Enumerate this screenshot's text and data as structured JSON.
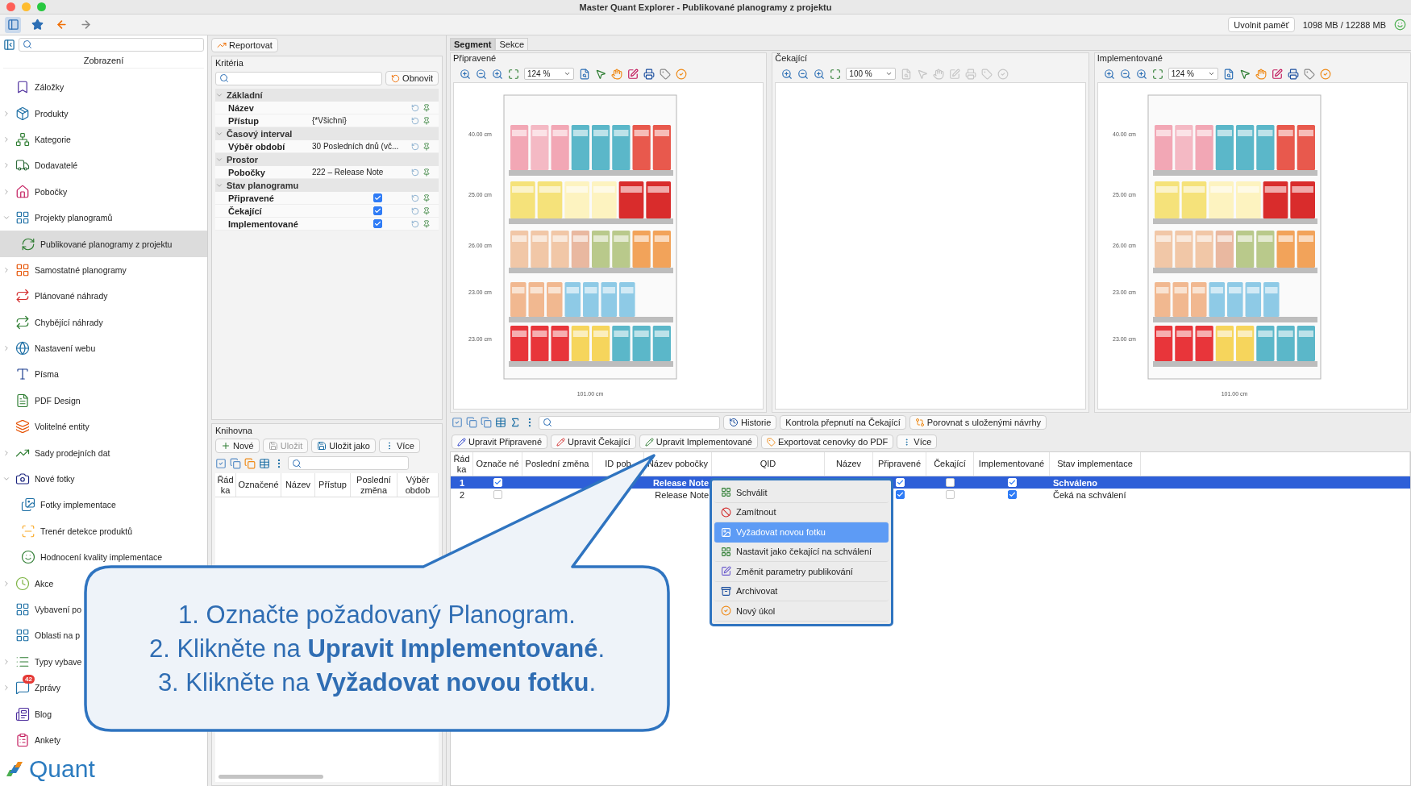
{
  "window": {
    "title": "Master Quant Explorer - Publikované planogramy z projektu"
  },
  "toolbar": {
    "memory_button": "Uvolnit paměť",
    "memory_usage": "1098 MB / 12288 MB"
  },
  "sidebar": {
    "heading": "Zobrazení",
    "logo": "Quant",
    "items": [
      {
        "label": "Záložky",
        "selected": false
      },
      {
        "label": "Produkty",
        "expanded": false,
        "selected": false
      },
      {
        "label": "Kategorie",
        "expanded": false,
        "selected": false
      },
      {
        "label": "Dodavatelé",
        "expanded": false,
        "selected": false
      },
      {
        "label": "Pobočky",
        "expanded": false,
        "selected": false
      },
      {
        "label": "Projekty planogramů",
        "expanded": true,
        "selected": false,
        "children": [
          {
            "label": "Publikované planogramy z projektu",
            "selected": true
          }
        ]
      },
      {
        "label": "Samostatné planogramy",
        "expanded": false,
        "selected": false
      },
      {
        "label": "Plánované náhrady",
        "selected": false
      },
      {
        "label": "Chybějící náhrady",
        "selected": false
      },
      {
        "label": "Nastavení webu",
        "expanded": false,
        "selected": false
      },
      {
        "label": "Písma",
        "selected": false
      },
      {
        "label": "PDF Design",
        "selected": false
      },
      {
        "label": "Volitelné entity",
        "selected": false
      },
      {
        "label": "Sady prodejních dat",
        "expanded": false,
        "selected": false
      },
      {
        "label": "Nové fotky",
        "expanded": true,
        "selected": false,
        "children": [
          {
            "label": "Fotky implementace",
            "selected": false
          },
          {
            "label": "Trenér detekce produktů",
            "selected": false
          },
          {
            "label": "Hodnocení kvality implementace",
            "selected": false
          }
        ]
      },
      {
        "label": "Akce",
        "expanded": false,
        "selected": false
      },
      {
        "label": "Vybavení po",
        "selected": false
      },
      {
        "label": "Oblasti na p",
        "selected": false
      },
      {
        "label": "Typy vybave",
        "expanded": false,
        "selected": false
      },
      {
        "label": "Zprávy",
        "expanded": false,
        "selected": false,
        "badge": "42"
      },
      {
        "label": "Blog",
        "selected": false
      },
      {
        "label": "Ankety",
        "selected": false
      }
    ]
  },
  "criteria": {
    "report_button": "Reportovat",
    "title": "Kritéria",
    "refresh_button": "Obnovit",
    "groups": [
      {
        "label": "Základní",
        "expanded": true,
        "rows": [
          {
            "kind": "text",
            "label": "Název"
          },
          {
            "kind": "text",
            "label": "Přístup",
            "value": "{*Všichni}"
          }
        ]
      },
      {
        "label": "Časový interval",
        "expanded": true,
        "rows": [
          {
            "kind": "text",
            "label": "Výběr období",
            "value": "30 Posledních dnů (vč..."
          }
        ]
      },
      {
        "label": "Prostor",
        "expanded": true,
        "rows": [
          {
            "kind": "text",
            "label": "Pobočky",
            "value": "222 – Release Note"
          }
        ]
      },
      {
        "label": "Stav planogramu",
        "expanded": true,
        "rows": [
          {
            "kind": "checkbox",
            "label": "Připravené",
            "checked": true
          },
          {
            "kind": "checkbox",
            "label": "Čekající",
            "checked": true
          },
          {
            "kind": "checkbox",
            "label": "Implementované",
            "checked": true
          }
        ]
      }
    ]
  },
  "library": {
    "title": "Knihovna",
    "buttons": [
      {
        "label": "Nové",
        "disabled": false
      },
      {
        "label": "Uložit",
        "disabled": true
      },
      {
        "label": "Uložit jako",
        "disabled": false
      },
      {
        "label": "Více",
        "disabled": false
      }
    ],
    "columns": [
      "Řád ka",
      "Označené",
      "Název",
      "Přístup",
      "Poslední změna",
      "Výběr obdob"
    ]
  },
  "tabs": [
    {
      "label": "Segment",
      "selected": true
    },
    {
      "label": "Sekce",
      "selected": false
    }
  ],
  "viewers": [
    {
      "title": "Připravené",
      "zoom": "124 %",
      "tools_disabled": false,
      "shelf_labels": [
        "40.00 cm",
        "25.00 cm",
        "26.00 cm",
        "23.00 cm",
        "23.00 cm"
      ],
      "width_label": "101.00 cm"
    },
    {
      "title": "Čekající",
      "zoom": "100 %",
      "tools_disabled": true
    },
    {
      "title": "Implementované",
      "zoom": "124 %",
      "tools_disabled": false,
      "shelf_labels": [
        "40.00 cm",
        "25.00 cm",
        "26.00 cm",
        "23.00 cm",
        "23.00 cm"
      ],
      "width_label": "101.00 cm"
    }
  ],
  "actions": {
    "top_buttons": [
      "Historie",
      "Kontrola přepnutí na Čekající",
      "Porovnat s uloženými návrhy"
    ],
    "edit_buttons": [
      "Upravit Připravené",
      "Upravit Čekající",
      "Upravit Implementované",
      "Exportovat cenovky do PDF",
      "Více"
    ]
  },
  "table": {
    "columns": [
      "Řád ka",
      "Označe né",
      "Poslední změna",
      "ID pob",
      "Název pobočky",
      "QID",
      "Název",
      "Připravené",
      "Čekající",
      "Implementované",
      "Stav implementace"
    ],
    "rows": [
      {
        "row": "1",
        "marked": true,
        "branch": "Release Note",
        "prepared": true,
        "waiting": false,
        "implemented": true,
        "status": "Schváleno",
        "selected": true
      },
      {
        "row": "2",
        "marked": false,
        "branch": "Release Note",
        "prepared": true,
        "waiting": false,
        "implemented": true,
        "status": "Čeká na schválení",
        "selected": false
      }
    ]
  },
  "context_menu": {
    "items": [
      {
        "label": "Schválit",
        "selected": false
      },
      {
        "label": "Zamítnout",
        "selected": false
      },
      {
        "label": "Vyžadovat novou fotku",
        "selected": true
      },
      {
        "label": "Nastavit jako čekající na schválení",
        "selected": false
      },
      {
        "label": "Změnit parametry publikování",
        "selected": false
      },
      {
        "label": "Archivovat",
        "selected": false
      },
      {
        "label": "Nový úkol",
        "selected": false
      }
    ]
  },
  "callout": {
    "lines": [
      "1. Označte požadovaný Planogram.",
      "2. Klikněte na **Upravit Implementované**.",
      "3. Klikněte na **Vyžadovat novou fotku**."
    ]
  }
}
